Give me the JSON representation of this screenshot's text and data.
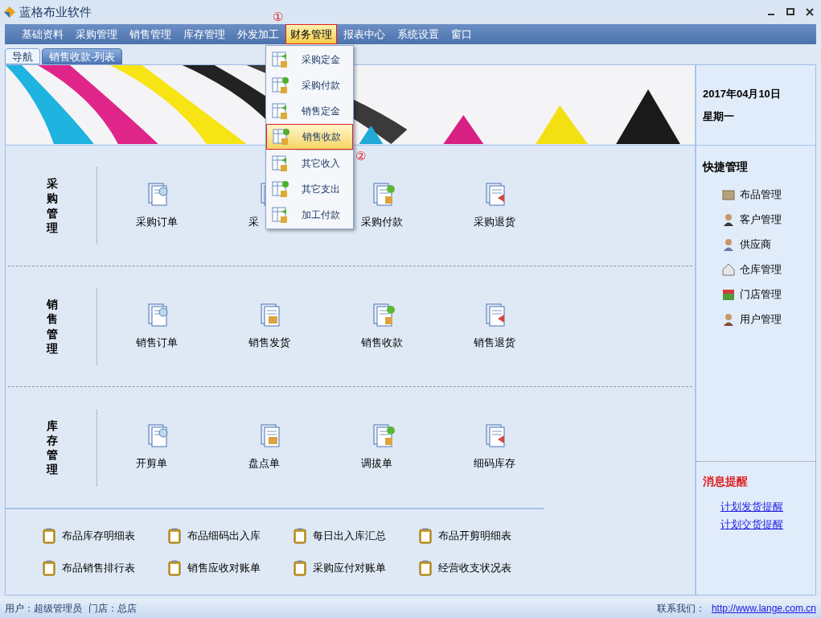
{
  "window": {
    "title": "蓝格布业软件"
  },
  "menu_bar": [
    {
      "label": "基础资料",
      "selected": false
    },
    {
      "label": "采购管理",
      "selected": false
    },
    {
      "label": "销售管理",
      "selected": false
    },
    {
      "label": "库存管理",
      "selected": false
    },
    {
      "label": "外发加工",
      "selected": false
    },
    {
      "label": "财务管理",
      "selected": true
    },
    {
      "label": "报表中心",
      "selected": false
    },
    {
      "label": "系统设置",
      "selected": false
    },
    {
      "label": "窗口",
      "selected": false
    }
  ],
  "annotations": [
    "①",
    "②"
  ],
  "tabs": [
    {
      "label": "导航",
      "selected": true
    },
    {
      "label": "销售收款-列表",
      "selected": false
    }
  ],
  "dropdown": [
    {
      "label": "采购定金",
      "selected": false
    },
    {
      "label": "采购付款",
      "selected": false
    },
    {
      "label": "销售定金",
      "selected": false
    },
    {
      "label": "销售收款",
      "selected": true
    },
    {
      "label": "其它收入",
      "selected": false
    },
    {
      "label": "其它支出",
      "selected": false
    },
    {
      "label": "加工付款",
      "selected": false
    }
  ],
  "banner": {
    "kind": "picture",
    "date": "2017年04月10日",
    "weekday": "星期一"
  },
  "sections": [
    {
      "title": "采购管理",
      "items": [
        "采购订单",
        "采",
        "采购付款",
        "采购退货"
      ]
    },
    {
      "title": "销售管理",
      "items": [
        "销售订单",
        "销售发货",
        "销售收款",
        "销售退货"
      ]
    },
    {
      "title": "库存管理",
      "items": [
        "开剪单",
        "盘点单",
        "调拔单",
        "细码库存"
      ]
    }
  ],
  "quick": {
    "title": "快捷管理",
    "items": [
      "布品管理",
      "客户管理",
      "供应商",
      "仓库管理",
      "门店管理",
      "用户管理"
    ]
  },
  "messages": {
    "title": "消息提醒",
    "links": [
      "计划发货提醒",
      "计划交货提醒"
    ]
  },
  "reports": [
    "布品库存明细表",
    "布品细码出入库",
    "每日出入库汇总",
    "布品开剪明细表",
    "布品销售排行表",
    "销售应收对账单",
    "采购应付对账单",
    "经营收支状况表"
  ],
  "status_bar": {
    "user": "用户：超级管理员",
    "store": "门店：总店",
    "contact": "联系我们：",
    "url": "http://www.lange.com.cn"
  }
}
